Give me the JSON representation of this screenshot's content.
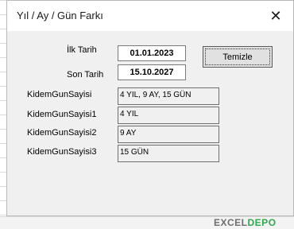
{
  "window": {
    "title": "Yıl / Ay / Gün Farkı"
  },
  "close_glyph": "✕",
  "form": {
    "start_label": "İlk Tarih",
    "start_value": "01.01.2023",
    "end_label": "Son Tarih",
    "end_value": "15.10.2027",
    "clear_button": "Temizle"
  },
  "outputs": [
    {
      "label": "KidemGunSayisi",
      "value": "4 YIL, 9 AY, 15 GÜN"
    },
    {
      "label": "KidemGunSayisi1",
      "value": "4 YIL"
    },
    {
      "label": "KidemGunSayisi2",
      "value": "9 AY"
    },
    {
      "label": "KidemGunSayisi3",
      "value": "15 GÜN"
    }
  ],
  "watermark": {
    "part1": "EXCEL",
    "part2": "DEPO"
  }
}
